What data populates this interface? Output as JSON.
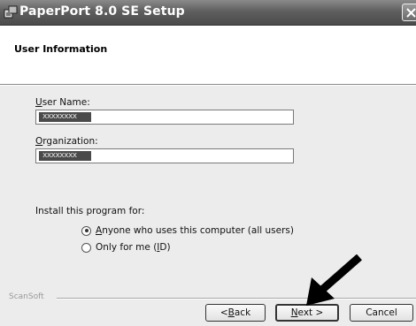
{
  "window": {
    "title": "PaperPort 8.0 SE Setup"
  },
  "header": {
    "title": "User Information"
  },
  "form": {
    "user_name": {
      "mnemonic": "U",
      "label_rest": "ser Name:",
      "value": "xxxxxxxx"
    },
    "organization": {
      "mnemonic": "O",
      "label_rest": "rganization:",
      "value": "xxxxxxxx"
    },
    "install_for_label": "Install this program for:",
    "options": [
      {
        "mnemonic": "A",
        "rest": "nyone who uses this computer (all users)",
        "selected": true
      },
      {
        "prefix": "Only for me (",
        "mnemonic": "I",
        "rest": "D)",
        "selected": false
      }
    ]
  },
  "footer": {
    "brand": "ScanSoft",
    "back_mnemonic": "B",
    "back_prefix": "< ",
    "back_rest": "ack",
    "next_mnemonic": "N",
    "next_rest": "ext >",
    "cancel": "Cancel"
  },
  "colors": {
    "title_bar": "#5f5f5f",
    "dialog_body": "#ececec",
    "selection": "#4a4a4a"
  },
  "icons": [
    "installer-icon",
    "close-icon",
    "pointer-arrow-icon"
  ]
}
